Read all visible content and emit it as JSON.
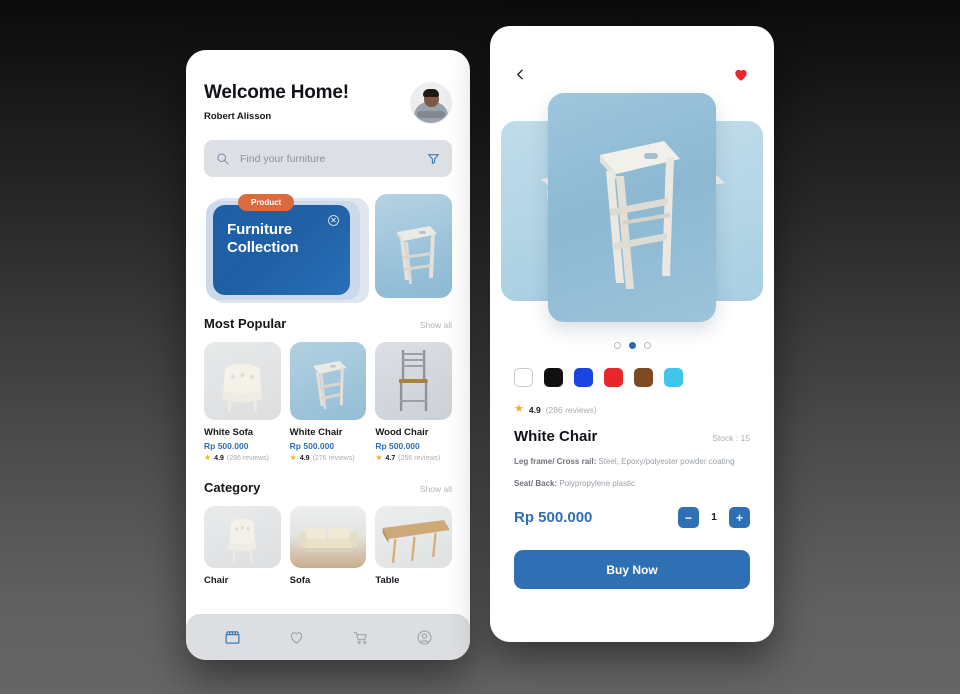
{
  "colors": {
    "primary_blue": "#2f6fb4",
    "banner_blue": "#1d5fa8",
    "badge_orange": "#dd6a3e",
    "star_yellow": "#f2b024",
    "heart_red": "#e8262b",
    "muted_gray": "#a9adb3"
  },
  "home": {
    "title": "Welcome Home!",
    "username": "Robert Alisson",
    "avatar_name": "user-avatar",
    "search": {
      "placeholder": "Find your furniture",
      "search_icon": "search-icon",
      "filter_icon": "filter-icon"
    },
    "banner": {
      "badge": "Product",
      "line1": "Furniture",
      "line2": "Collection",
      "close_icon": "close-circle-icon"
    },
    "popular": {
      "heading": "Most Popular",
      "show_all": "Show all",
      "items": [
        {
          "name": "White Sofa",
          "price": "Rp 500.000",
          "rating": "4.9",
          "reviews": "(286 reviews)"
        },
        {
          "name": "White Chair",
          "price": "Rp 500.000",
          "rating": "4.9",
          "reviews": "(276 reviews)"
        },
        {
          "name": "Wood Chair",
          "price": "Rp 500.000",
          "rating": "4.7",
          "reviews": "(256 reviews)"
        }
      ]
    },
    "category": {
      "heading": "Category",
      "show_all": "Show all",
      "items": [
        {
          "name": "Chair"
        },
        {
          "name": "Sofa"
        },
        {
          "name": "Table"
        }
      ]
    },
    "nav": [
      {
        "icon": "store-icon",
        "active": true
      },
      {
        "icon": "heart-icon",
        "active": false
      },
      {
        "icon": "cart-icon",
        "active": false
      },
      {
        "icon": "profile-icon",
        "active": false
      }
    ]
  },
  "detail": {
    "back_icon": "back-chevron-icon",
    "favorite_icon": "heart-filled-icon",
    "carousel": {
      "dots": 3,
      "active_index": 1
    },
    "swatches": [
      {
        "name": "white",
        "hex": "#ffffff"
      },
      {
        "name": "black",
        "hex": "#101010"
      },
      {
        "name": "blue",
        "hex": "#1b45e0"
      },
      {
        "name": "red",
        "hex": "#e8262b"
      },
      {
        "name": "brown",
        "hex": "#7d4a22"
      },
      {
        "name": "cyan",
        "hex": "#3fc6ea"
      }
    ],
    "rating": "4.9",
    "reviews": "(286 reviews)",
    "title": "White Chair",
    "stock": "Stock : 15",
    "spec1_label": "Leg frame/ Cross rail:",
    "spec1_value": " Steel, Epoxy/polyester powder coating",
    "spec2_label": "Seat/ Back:",
    "spec2_value": " Polypropylene plastic",
    "price": "Rp 500.000",
    "quantity": "1",
    "minus_label": "−",
    "plus_label": "+",
    "buy_label": "Buy Now"
  }
}
